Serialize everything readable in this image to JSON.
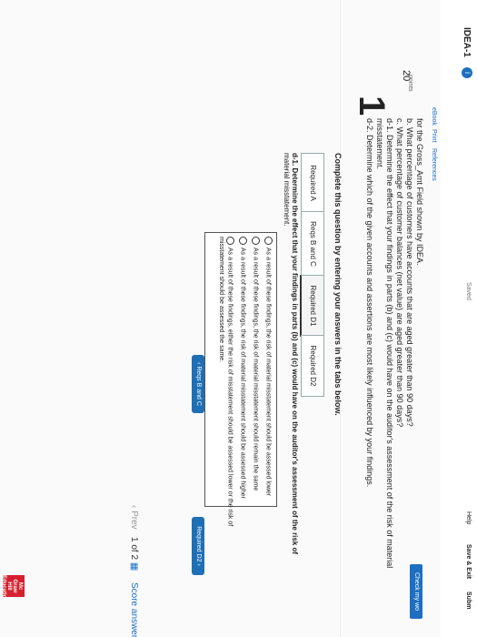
{
  "header": {
    "title": "IDEA-1",
    "info_badge": "i",
    "saved": "Saved",
    "help": "Help",
    "save_exit": "Save & Exit",
    "submit": "Subm",
    "check_my_work": "Check my wo"
  },
  "question": {
    "number": "1",
    "points": "20",
    "points_label": "points",
    "lines": [
      "for the Gross_Amt Field shown by IDEA.",
      "b. What percentage of customers have accounts that are aged greater than 90 days?",
      "c. What percentage of customer balances (net value) are aged greater than 90 days?",
      "d-1. Determine the effect that your findings in parts (b) and (c) would have on the auditor's assessment of the risk of material",
      "misstatement.",
      "d-2. Determine which of the given accounts and assertions are most likely influenced by your findings."
    ],
    "instruction": "Complete this question by entering your answers in the tabs below."
  },
  "sidebar": {
    "ebook": "eBook",
    "print": "Print",
    "references": "References"
  },
  "tabs": [
    "Required A",
    "Reqs B and C",
    "Required D1",
    "Required D2"
  ],
  "prompt": {
    "line1": "d-1. Determine the effect that your findings in parts (b) and (c) would have on the auditor's assessment of the risk of",
    "line2": "material misstatement."
  },
  "options": [
    "As a result of these findings, the risk of material misstatement should be assessed lower",
    "As a result of these findings, the risk of material misstatement should remain the same",
    "As a result of these findings, the risk of material misstatement should be assessed higher",
    "As a result of these findings, either the risk of misstatement should be assessed lower or the risk of",
    "misstatement should be assessed the same."
  ],
  "subnav": {
    "prev": "Reqs B and C",
    "next": "Required D2"
  },
  "footer": {
    "prev": "Prev",
    "page_current": "1",
    "page_of": "of",
    "page_total": "2",
    "score": "Score answer"
  },
  "logo": {
    "lines": [
      "Mc",
      "Graw",
      "Hill",
      "Education"
    ]
  }
}
